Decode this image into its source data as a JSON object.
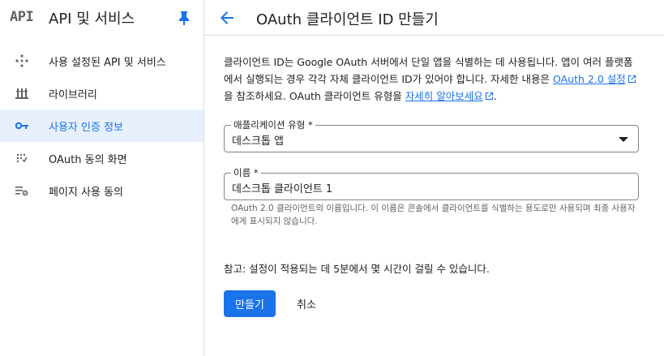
{
  "sidebar": {
    "logo_text": "API",
    "title": "API 및 서비스",
    "items": [
      {
        "label": "사용 설정된 API 및 서비스",
        "icon": "diamond-dots-icon"
      },
      {
        "label": "라이브러리",
        "icon": "library-icon"
      },
      {
        "label": "사용자 인증 정보",
        "icon": "key-icon",
        "active": true
      },
      {
        "label": "OAuth 동의 화면",
        "icon": "consent-dots-icon"
      },
      {
        "label": "페이지 사용 동의",
        "icon": "settings-list-icon"
      }
    ]
  },
  "header": {
    "title": "OAuth 클라이언트 ID 만들기"
  },
  "description": {
    "part1": "클라이언트 ID는 Google OAuth 서버에서 단일 앱을 식별하는 데 사용됩니다. 앱이 여러 플랫폼에서 실행되는 경우 각각 자체 클라이언트 ID가 있어야 합니다. 자세한 내용은 ",
    "link1": "OAuth 2.0 설정",
    "part2": "을 참조하세요. OAuth 클라이언트 유형을 ",
    "link2": "자세히 알아보세요",
    "part3": "."
  },
  "form": {
    "app_type_label": "애플리케이션 유형 *",
    "app_type_value": "데스크톱 앱",
    "name_label": "이름 *",
    "name_value": "데스크톱 클라이언트 1",
    "name_hint": "OAuth 2.0 클라이언트의 이름입니다. 이 이름은 콘솔에서 클라이언트를 식별하는 용도로만 사용되며 최종 사용자에게 표시되지 않습니다."
  },
  "note": "참고: 설정이 적용되는 데 5분에서 몇 시간이 걸릴 수 있습니다.",
  "actions": {
    "create_label": "만들기",
    "cancel_label": "취소"
  },
  "colors": {
    "accent": "#1a73e8",
    "active_bg": "#e8f0fe",
    "icon_gray": "#5f6368"
  }
}
